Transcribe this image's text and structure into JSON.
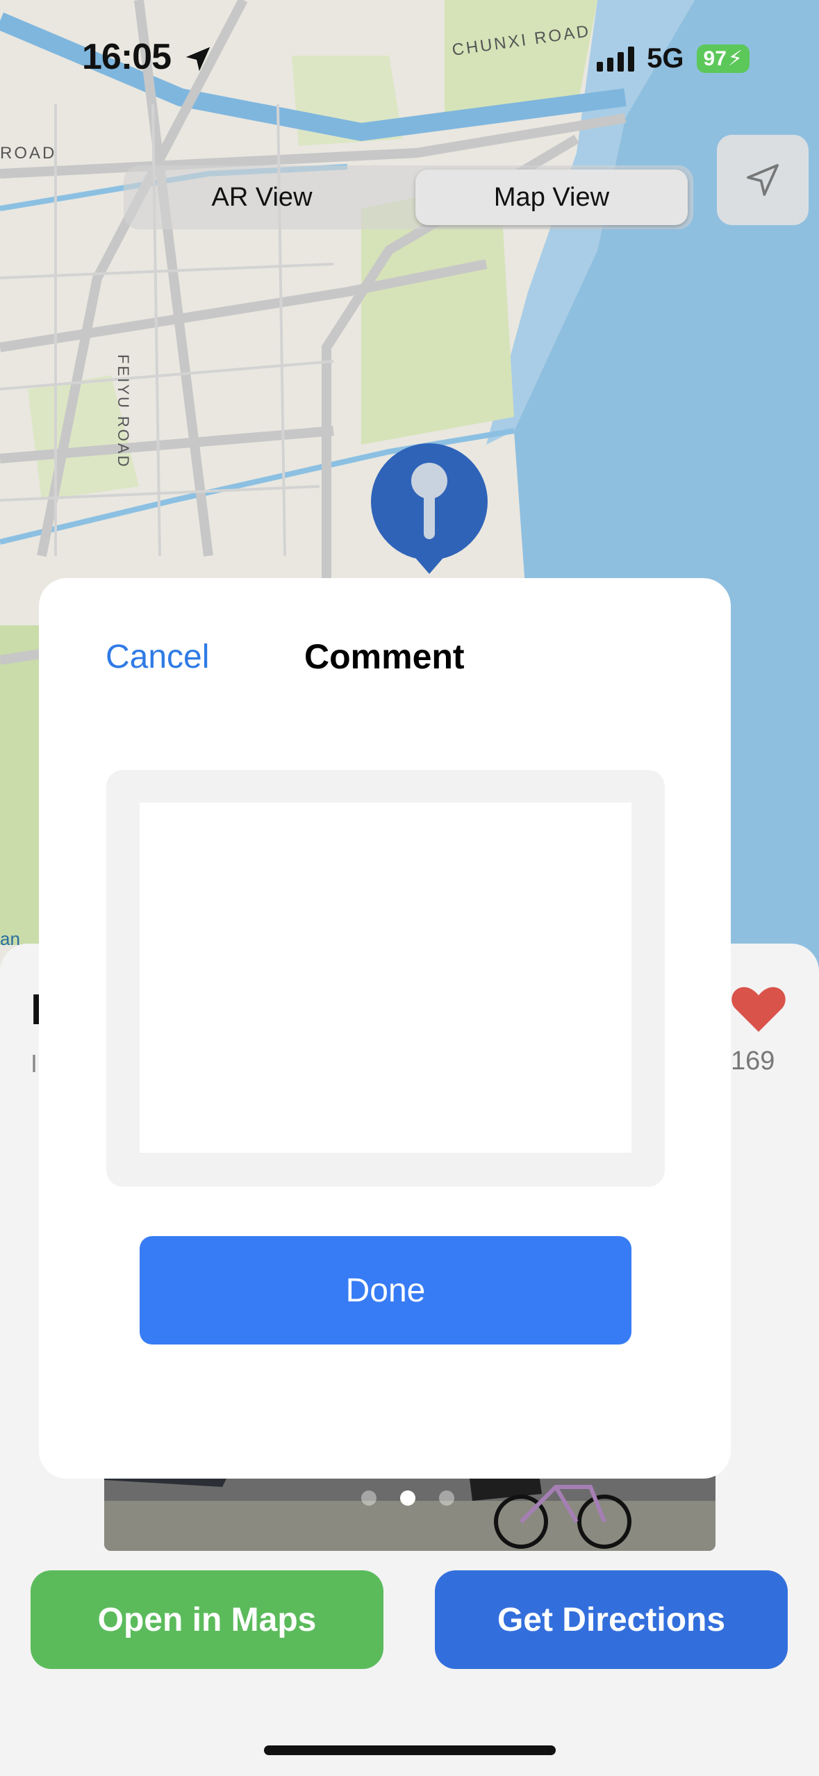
{
  "status_bar": {
    "time": "16:05",
    "network": "5G",
    "battery": "97"
  },
  "map": {
    "road_labels": {
      "chunxi": "CHUNXI ROAD",
      "feiyu": "FEIYU ROAD",
      "left_road": "ROAD",
      "edge": "an"
    },
    "view_toggle": {
      "ar_label": "AR View",
      "map_label": "Map View",
      "selected": "Map View"
    }
  },
  "place": {
    "likes": "169"
  },
  "modal": {
    "cancel_label": "Cancel",
    "title": "Comment",
    "comment_value": "",
    "done_label": "Done"
  },
  "gallery": {
    "page_count": 3,
    "current_page": 2
  },
  "actions": {
    "open_maps_label": "Open in Maps",
    "directions_label": "Get Directions"
  },
  "colors": {
    "accent_blue": "#377cf4",
    "maps_green": "#5bbb5b",
    "directions_blue": "#336fdc",
    "heart_red": "#d9534a"
  }
}
